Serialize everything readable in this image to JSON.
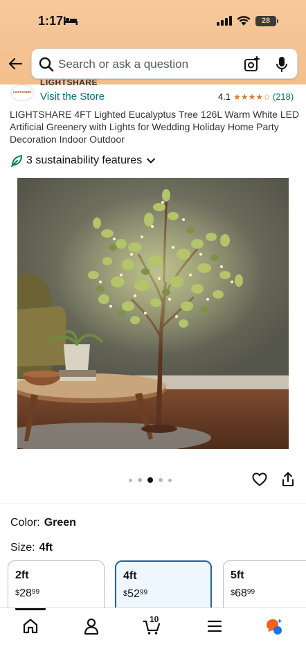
{
  "status_bar": {
    "time": "1:17",
    "battery": "28"
  },
  "search": {
    "placeholder": "Search or ask a question"
  },
  "brand": {
    "logo_text": "LIGHTSHARE",
    "name": "LIGHTSHARE",
    "visit_link": "Visit the Store"
  },
  "rating": {
    "value": "4.1",
    "stars": "★★★★☆",
    "count": "(218)"
  },
  "product": {
    "title": "LIGHTSHARE 4FT Lighted Eucalyptus Tree 126L Warm White LED Artificial Greenery with Lights for Wedding Holiday Home Party Decoration Indoor Outdoor"
  },
  "sustainability": {
    "label": "3 sustainability features"
  },
  "gallery": {
    "dot_count": 5,
    "active_index": 2
  },
  "variation": {
    "color_label": "Color:",
    "color_value": "Green",
    "size_label": "Size:",
    "size_value": "4ft",
    "options": [
      {
        "name": "2ft",
        "currency": "$",
        "whole": "28",
        "fraction": "99"
      },
      {
        "name": "4ft",
        "currency": "$",
        "whole": "52",
        "fraction": "99"
      },
      {
        "name": "5ft",
        "currency": "$",
        "whole": "68",
        "fraction": "99"
      }
    ]
  },
  "bottom_nav": {
    "cart_count": "10"
  },
  "colors": {
    "header": "#f3bf8c",
    "link": "#007185",
    "star": "#de7921",
    "selected_border": "#2162a1"
  }
}
